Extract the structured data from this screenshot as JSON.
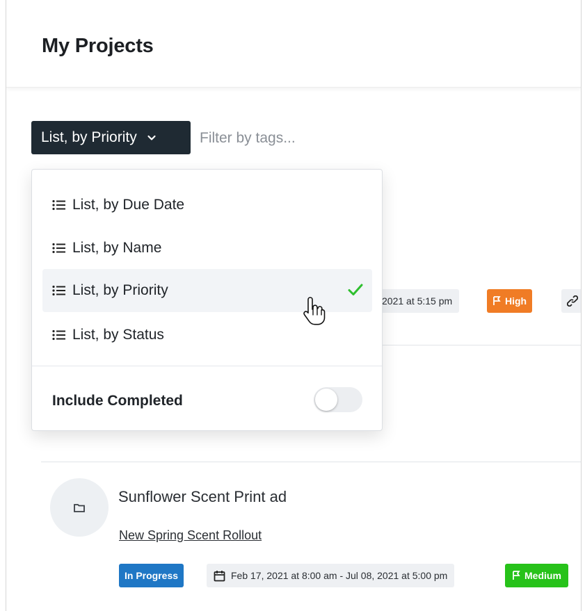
{
  "header": {
    "title": "My Projects"
  },
  "toolbar": {
    "view_label": "List, by Priority",
    "filter_placeholder": "Filter by tags..."
  },
  "dropdown": {
    "items": [
      {
        "label": "List, by Due Date",
        "selected": false
      },
      {
        "label": "List, by Name",
        "selected": false
      },
      {
        "label": "List, by Priority",
        "selected": true
      },
      {
        "label": "List, by Status",
        "selected": false
      }
    ],
    "include_completed": {
      "label": "Include Completed",
      "on": false
    }
  },
  "background_project": {
    "date_partial": "2021 at 5:15 pm",
    "priority": "High"
  },
  "project": {
    "name": "Sunflower Scent Print ad",
    "parent": "New Spring Scent Rollout",
    "status": "In Progress",
    "dates": "Feb 17, 2021 at 8:00 am - Jul 08, 2021 at 5:00 pm",
    "priority": "Medium"
  },
  "colors": {
    "view_button_bg": "#1f2a33",
    "high": "#f07c25",
    "medium": "#27c21a",
    "in_progress": "#1f77c5",
    "check": "#2fbf2f"
  },
  "icons": {
    "list": "list-icon",
    "check": "check-icon",
    "folder": "folder-icon",
    "calendar": "calendar-icon",
    "flag": "flag-icon",
    "link": "link-icon",
    "chevron": "chevron-down-icon",
    "cursor": "hand-pointer-icon"
  }
}
